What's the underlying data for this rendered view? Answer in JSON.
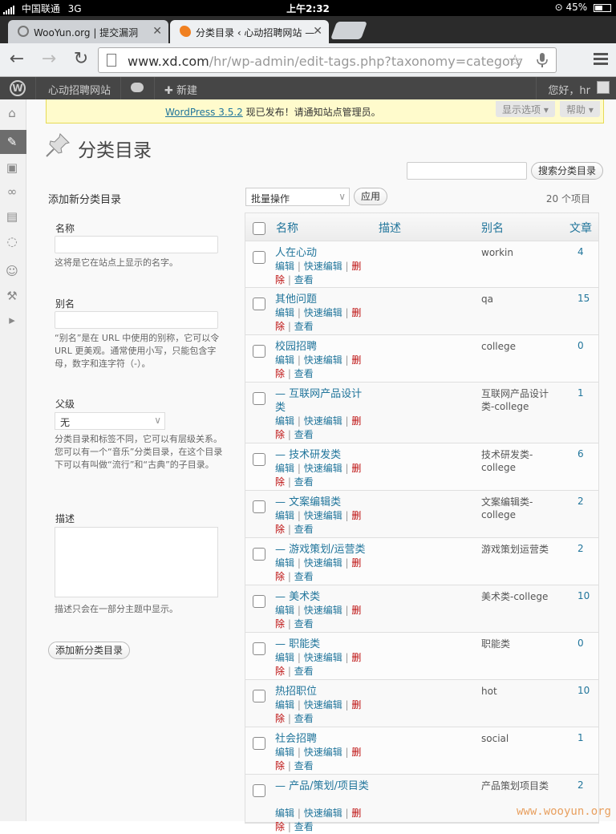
{
  "status": {
    "carrier": "中国联通",
    "network": "3G",
    "time": "上午2:32",
    "battery": "45%"
  },
  "tabs": [
    {
      "title": "WooYun.org | 提交漏洞",
      "active": false
    },
    {
      "title": "分类目录 ‹ 心动招聘网站 —",
      "active": true
    }
  ],
  "omnibox": {
    "host": "www.xd.com",
    "path": "/hr/wp-admin/edit-tags.php?taxonomy=category"
  },
  "adminbar": {
    "site": "心动招聘网站",
    "new": "新建",
    "howdy": "您好，hr"
  },
  "notice": {
    "link": "WordPress 3.5.2",
    "text": " 现已发布！请通知站点管理员。"
  },
  "screen_options": "显示选项 ▾",
  "help": "帮助 ▾",
  "page_title": "分类目录",
  "search_button": "搜索分类目录",
  "form": {
    "heading": "添加新分类目录",
    "name_label": "名称",
    "name_help": "这将是它在站点上显示的名字。",
    "slug_label": "别名",
    "slug_help": "“别名”是在 URL 中使用的别称，它可以令 URL 更美观。通常使用小写，只能包含字母，数字和连字符（-）。",
    "parent_label": "父级",
    "parent_value": "无",
    "parent_help": "分类目录和标签不同，它可以有层级关系。您可以有一个“音乐”分类目录，在这个目录下可以有叫做“流行”和“古典”的子目录。",
    "desc_label": "描述",
    "desc_help": "描述只会在一部分主题中显示。",
    "submit": "添加新分类目录"
  },
  "table": {
    "bulk": "批量操作",
    "apply": "应用",
    "count": "20 个项目",
    "headers": {
      "name": "名称",
      "desc": "描述",
      "slug": "别名",
      "posts": "文章"
    },
    "actions": {
      "edit": "编辑",
      "quick": "快速编辑",
      "del1": "删",
      "del2": "除",
      "view": "查看"
    },
    "rows": [
      {
        "name": "人在心动",
        "slug": "workin",
        "count": "4"
      },
      {
        "name": "其他问题",
        "slug": "qa",
        "count": "15"
      },
      {
        "name": "校园招聘",
        "slug": "college",
        "count": "0"
      },
      {
        "name": "— 互联网产品设计类",
        "slug": "互联网产品设计类-college",
        "count": "1"
      },
      {
        "name": "— 技术研发类",
        "slug": "技术研发类-college",
        "count": "6"
      },
      {
        "name": "— 文案编辑类",
        "slug": "文案编辑类-college",
        "count": "2"
      },
      {
        "name": "— 游戏策划/运营类",
        "slug": "游戏策划运营类",
        "count": "2"
      },
      {
        "name": "— 美术类",
        "slug": "美术类-college",
        "count": "10"
      },
      {
        "name": "— 职能类",
        "slug": "职能类",
        "count": "0"
      },
      {
        "name": "热招职位",
        "slug": "hot",
        "count": "10"
      },
      {
        "name": "社会招聘",
        "slug": "social",
        "count": "1"
      },
      {
        "name": "— 产品/策划/项目类",
        "slug": "产品策划项目类",
        "count": "2"
      }
    ]
  },
  "watermark": "www.wooyun.org"
}
